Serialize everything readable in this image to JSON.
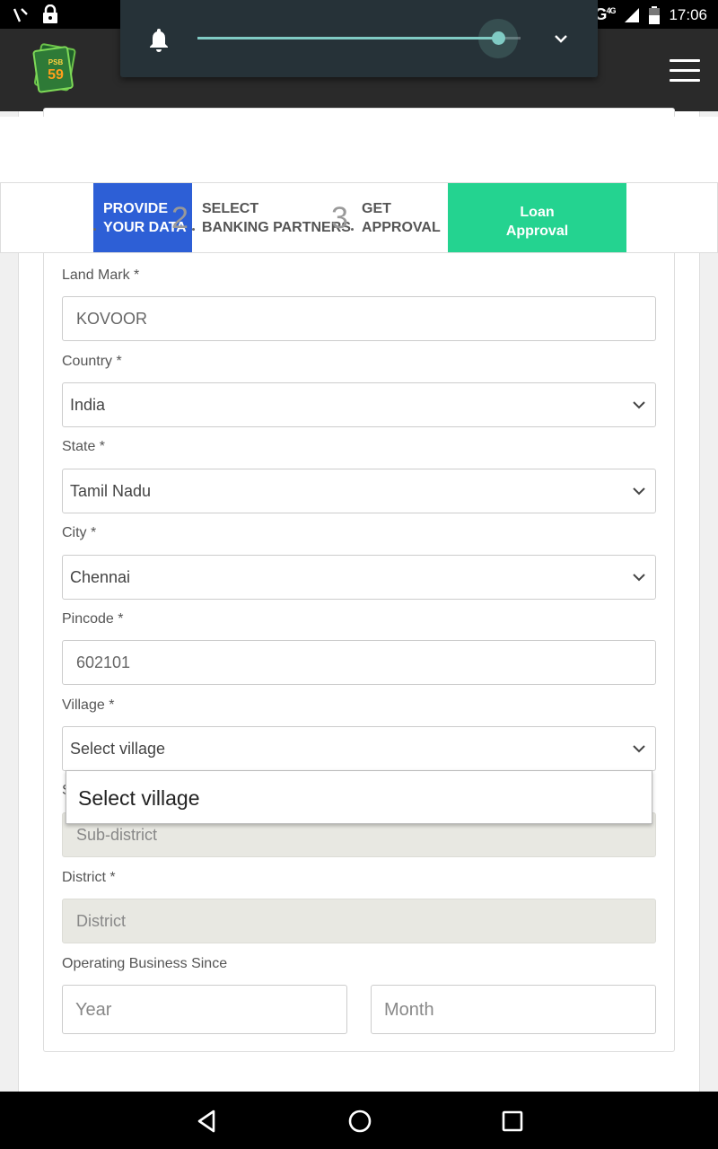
{
  "status_bar": {
    "network": "4G",
    "network_sup": "4G",
    "time": "17:06"
  },
  "app": {
    "logo_top": "PSB",
    "logo_num": "59"
  },
  "volume": {
    "level_percent": 93
  },
  "steps": {
    "step1": {
      "line1": "PROVIDE",
      "line2": "YOUR DATA"
    },
    "step2": {
      "num": "2",
      "line1": "SELECT",
      "line2": "BANKING PARTNERS"
    },
    "step3": {
      "num": "3",
      "line1": "GET",
      "line2": "APPROVAL"
    },
    "loan": {
      "line1": "Loan",
      "line2": "Approval"
    }
  },
  "form": {
    "landmark": {
      "label": "Land Mark *",
      "value": "KOVOOR"
    },
    "country": {
      "label": "Country *",
      "value": "India"
    },
    "state": {
      "label": "State *",
      "value": "Tamil Nadu"
    },
    "city": {
      "label": "City *",
      "value": "Chennai"
    },
    "pincode": {
      "label": "Pincode *",
      "value": "602101"
    },
    "village": {
      "label": "Village *",
      "value": "Select village"
    },
    "subdistrict": {
      "label": "S",
      "placeholder": "Sub-district"
    },
    "district": {
      "label": "District *",
      "placeholder": "District"
    },
    "business_since": {
      "label": "Operating Business Since",
      "year_placeholder": "Year",
      "month_placeholder": "Month"
    }
  },
  "popup": {
    "option": "Select village"
  },
  "colors": {
    "step_active": "#2d5fd6",
    "loan_green": "#24d390",
    "volume_accent": "#80cbc4"
  }
}
